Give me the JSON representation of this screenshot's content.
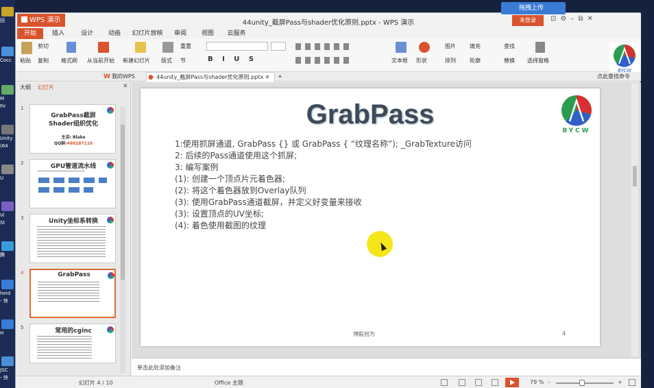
{
  "desktop": {
    "labels": [
      "回",
      "Cocc",
      "M",
      "Fir",
      "Unity",
      "(64",
      "U",
      "Vi",
      "St",
      "腾",
      "heid",
      "- 快",
      "H",
      "JSC",
      "- 快"
    ]
  },
  "titlebar": {
    "app_name": "WPS 演示",
    "doc_title": "44unity_截屏Pass与shader优化原则.pptx - WPS 演示",
    "cloud_button": "拖拽上传",
    "login": "未登录"
  },
  "menu": {
    "tabs": [
      "开始",
      "插入",
      "设计",
      "动画",
      "幻灯片放映",
      "审阅",
      "视图",
      "云服务"
    ],
    "active": "开始"
  },
  "ribbon": {
    "paste": "粘贴",
    "cut": "剪切",
    "copy": "复制",
    "format_painter": "格式刷",
    "from_current": "从当前开始",
    "new_slide": "新建幻灯片",
    "layout": "版式",
    "reset": "重置",
    "section": "节",
    "textbox": "文本框",
    "shape": "形状",
    "picture": "图片",
    "arrange": "排列",
    "fill": "填充",
    "outline": "轮廓",
    "find": "查找",
    "replace": "替换",
    "select_pane": "选择窗格",
    "logo_text": "BYCW"
  },
  "doctabs": {
    "my_wps": "我的WPS",
    "current_doc": "44unity_截屏Pass与shader优化原则.pptx",
    "find_command": "点此查找命令"
  },
  "leftpanel": {
    "tab_outline": "大纲",
    "tab_slides": "幻灯片",
    "thumbs": [
      {
        "num": "1",
        "title": "GrabPass截屏",
        "title2": "Shader组织优化",
        "sub1": "主讲: Blake",
        "sub2": "QQ群:",
        "qq": "480287110"
      },
      {
        "num": "2",
        "title": "GPU管道流水线"
      },
      {
        "num": "3",
        "title": "Unity坐标系转换"
      },
      {
        "num": "4",
        "title": "GrabPass"
      },
      {
        "num": "5",
        "title": "常用的cginc"
      }
    ],
    "add_button": "+"
  },
  "slide": {
    "title": "GrabPass",
    "logo_text": "BYCW",
    "lines": [
      "1:使用抓屏通道, GrabPass {} 或 GrabPass { “纹理名称”); _GrabTexture访问",
      "2: 后续的Pass通道使用这个抓屏;",
      "3: 编写案例",
      " (1): 创建一个顶点片元着色器;",
      " (2): 将这个着色器放到Overlay队列",
      " (3): 使用GrabPass通道截屏，并定义好变量来接收",
      " (3): 设置顶点的UV坐标;",
      "  (4): 着色使用截图的纹理"
    ],
    "footer": "博毅创为",
    "page_number": "4"
  },
  "notes": {
    "placeholder": "单击此处添加备注"
  },
  "statusbar": {
    "slide_counter": "幻灯片 4 / 10",
    "theme": "Office 主题",
    "zoom": "79 %",
    "zoom_fraction": 0.45
  },
  "colors": {
    "accent": "#d9532c",
    "title": "#3d4a5a"
  }
}
